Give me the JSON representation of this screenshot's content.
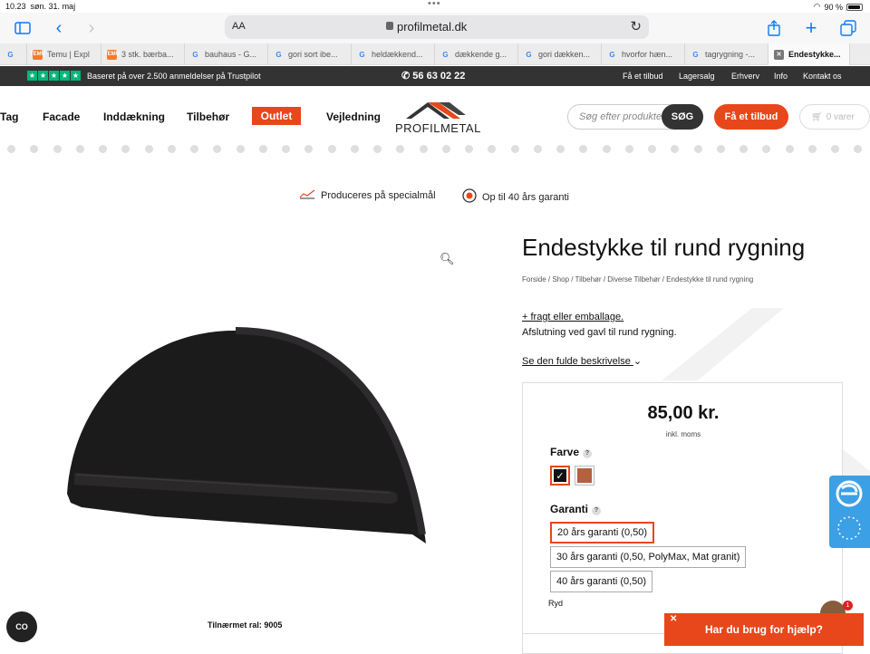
{
  "status": {
    "time": "10.23",
    "date": "søn. 31. maj",
    "battery": "90 %"
  },
  "browser": {
    "aa": "AA",
    "url": "profilmetal.dk"
  },
  "tabs": [
    {
      "label": "",
      "fav": "g"
    },
    {
      "label": "Temu | Expl",
      "fav": "t"
    },
    {
      "label": "3 stk. bærba...",
      "fav": "t"
    },
    {
      "label": "bauhaus - G...",
      "fav": "g"
    },
    {
      "label": "gori sort ibe...",
      "fav": "g"
    },
    {
      "label": "heldækkend...",
      "fav": "g"
    },
    {
      "label": "dækkende g...",
      "fav": "g"
    },
    {
      "label": "gori dækken...",
      "fav": "g"
    },
    {
      "label": "hvorfor hæn...",
      "fav": "g"
    },
    {
      "label": "tagrygning -...",
      "fav": "g"
    },
    {
      "label": "Endestykke...",
      "fav": "x"
    }
  ],
  "topbar": {
    "trustpilot": "Baseret på over 2.500 anmeldelser på Trustpilot",
    "phone": "56 63 02 22",
    "links": [
      "Få et tilbud",
      "Lagersalg",
      "Erhverv",
      "Info",
      "Kontakt os"
    ]
  },
  "nav": {
    "items": [
      "Tag",
      "Facade",
      "Inddækning",
      "Tilbehør"
    ],
    "outlet": "Outlet",
    "guide": "Vejledning"
  },
  "logo": {
    "text": "PROFILMETAL"
  },
  "search": {
    "placeholder": "Søg efter produkter",
    "button": "SØG"
  },
  "quote_button": "Få et tilbud",
  "cart": "0 varer",
  "usp": {
    "made": "Produceres på specialmål",
    "warranty": "Op til 40 års garanti"
  },
  "product": {
    "title": "Endestykke til rund rygning",
    "breadcrumb": "Forside / Shop / Tilbehør / Diverse Tilbehør / Endestykke til rund rygning",
    "freight": "+ fragt eller emballage.",
    "desc": "Afslutning ved gavl til rund rygning.",
    "more": "Se den fulde beskrivelse",
    "caption": "Tilnærmet ral: 9005",
    "price": "85,00 kr.",
    "vat": "inkl. moms",
    "color_label": "Farve",
    "colors": [
      "#111111",
      "#b5603e"
    ],
    "warranty_label": "Garanti",
    "warranty_options": [
      "20 års garanti (0,50)",
      "30 års garanti (0,50, PolyMax, Mat granit)",
      "40 års garanti (0,50)"
    ],
    "reset": "Ryd"
  },
  "chat": {
    "label": "Har du brug for hjælp?",
    "notifications": "1"
  },
  "consent": "CO"
}
